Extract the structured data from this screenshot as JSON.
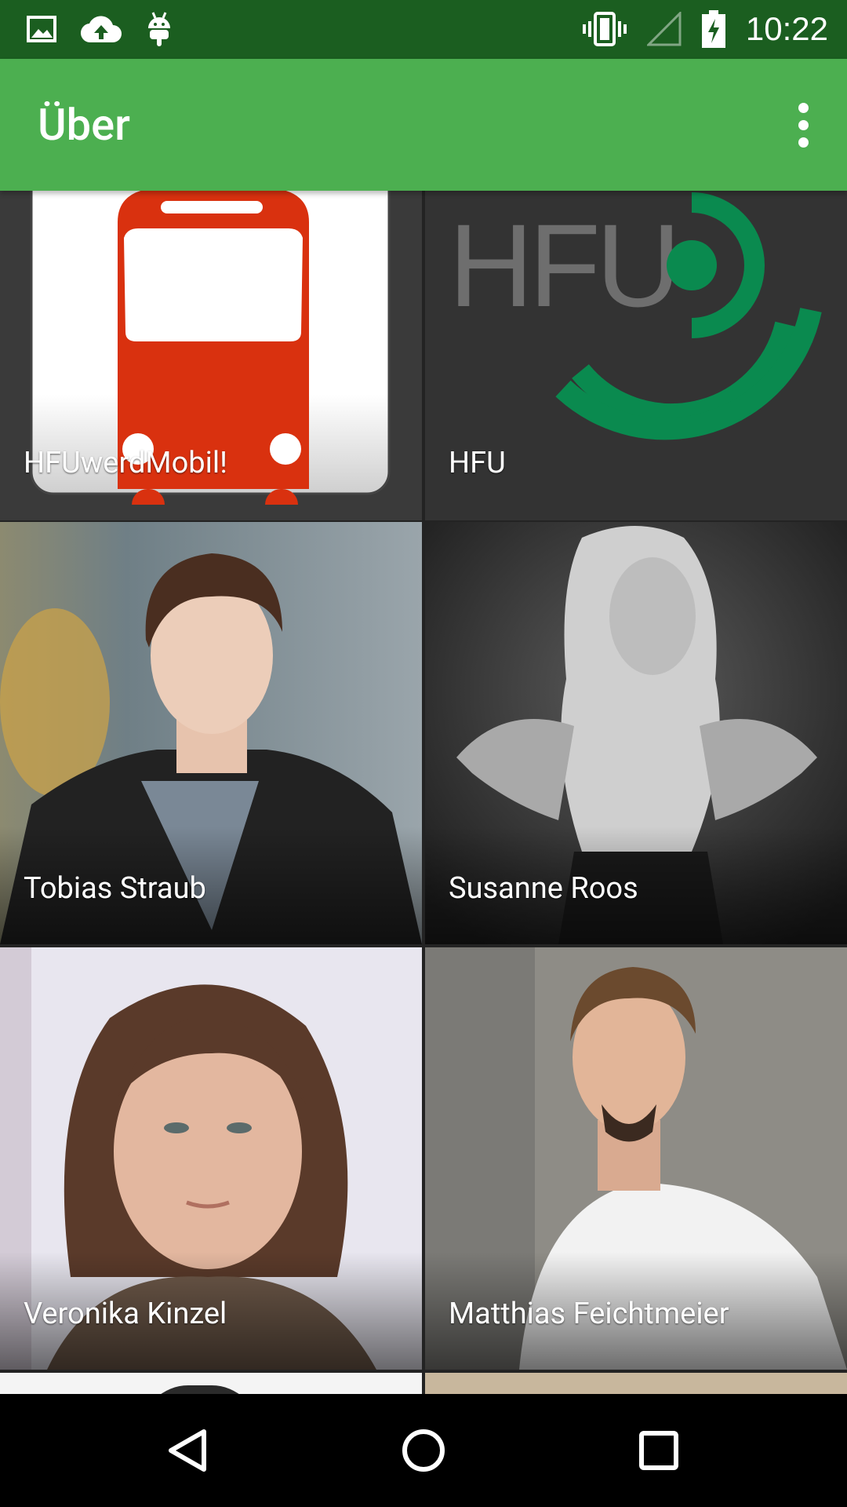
{
  "status_bar": {
    "time": "10:22",
    "icons": [
      "image-icon",
      "cloud-upload-icon",
      "android-icon",
      "vibrate-icon",
      "signal-icon",
      "battery-charging-icon"
    ]
  },
  "app_bar": {
    "title": "Über",
    "menu_icon": "overflow-menu-icon"
  },
  "grid": {
    "tiles": [
      {
        "label": "HFUwerdMobil!",
        "image": "bus-logo"
      },
      {
        "label": "HFU",
        "image": "hfu-logo"
      },
      {
        "label": "Tobias Straub",
        "image": "portrait-photo"
      },
      {
        "label": "Susanne Roos",
        "image": "portrait-photo"
      },
      {
        "label": "Veronika Kinzel",
        "image": "portrait-photo"
      },
      {
        "label": "Matthias Feichtmeier",
        "image": "portrait-photo"
      }
    ]
  },
  "nav_bar": {
    "icons": [
      "back-icon",
      "home-icon",
      "recents-icon"
    ]
  }
}
